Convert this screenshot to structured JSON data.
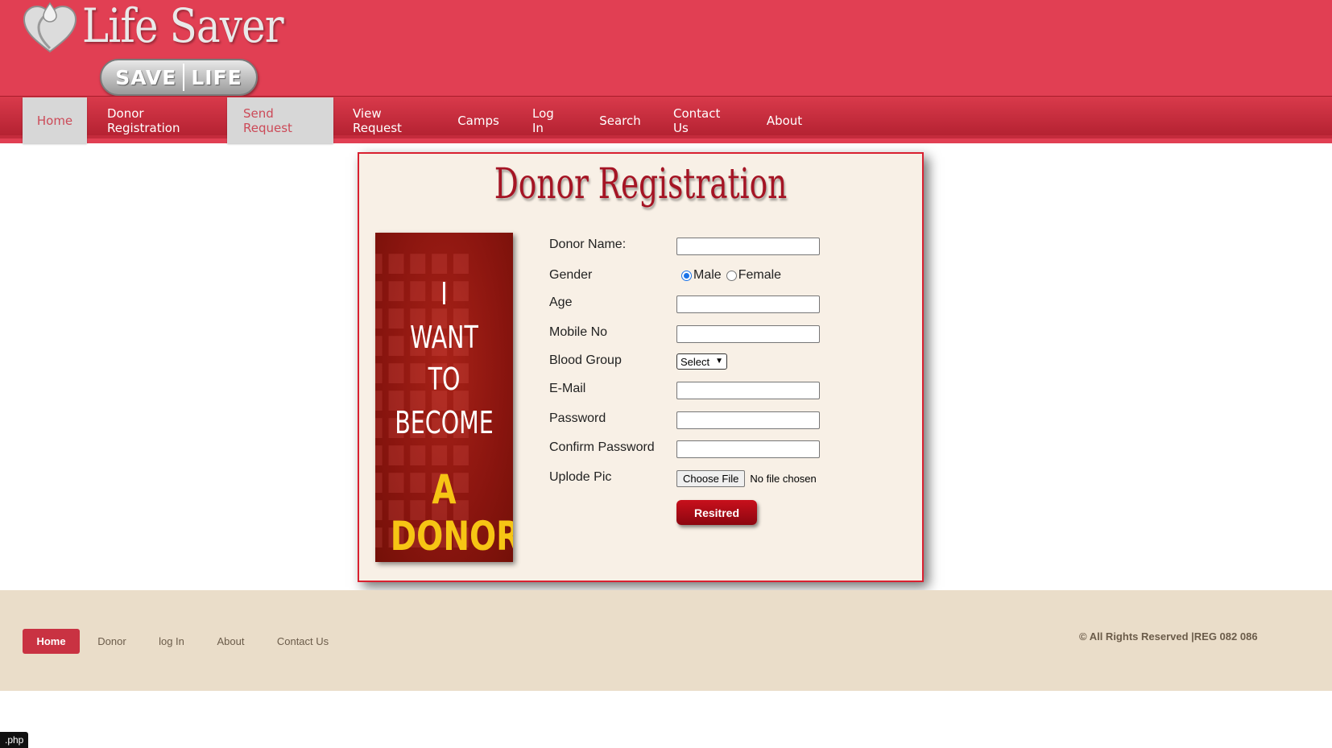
{
  "header": {
    "logo_title": "Life Saver",
    "logo_badge_left": "SAVE",
    "logo_badge_right": "LIFE"
  },
  "nav": [
    {
      "label": "Home",
      "active": true
    },
    {
      "label": "Donor Registration",
      "active": false
    },
    {
      "label": "Send Request",
      "active": true
    },
    {
      "label": "View Request",
      "active": false
    },
    {
      "label": "Camps",
      "active": false
    },
    {
      "label": "Log In",
      "active": false
    },
    {
      "label": "Search",
      "active": false
    },
    {
      "label": "Contact Us",
      "active": false
    },
    {
      "label": "About",
      "active": false
    }
  ],
  "main": {
    "title": "Donor Registration",
    "banner": {
      "line1": "I",
      "line2": "WANT",
      "line3": "TO",
      "line4": "BECOME",
      "line5": "A DONOR"
    },
    "form": {
      "donor_name_label": "Donor Name:",
      "donor_name_value": "",
      "gender_label": "Gender",
      "gender_options": [
        "Male",
        "Female"
      ],
      "gender_selected": "Male",
      "age_label": "Age",
      "mobile_label": "Mobile No",
      "blood_group_label": "Blood Group",
      "blood_group_selected": "Select",
      "email_label": "E-Mail",
      "password_label": "Password",
      "confirm_password_label": "Confirm Password",
      "upload_label": "Uplode Pic",
      "file_button": "Choose File",
      "file_status": "No file chosen",
      "submit_label": "Resitred"
    }
  },
  "footer": {
    "links": [
      "Home",
      "Donor",
      "log In",
      "About",
      "Contact Us"
    ],
    "copyright": "© All Rights Reserved |REG 082 086"
  },
  "status_tab": ".php",
  "colors": {
    "header_red": "#e13f53",
    "nav_red": "#c42b3c",
    "panel_bg": "#f8f0e6",
    "footer_bg": "#eaddc9",
    "accent_dark_red": "#a51424",
    "banner_yellow": "#f6c514"
  }
}
